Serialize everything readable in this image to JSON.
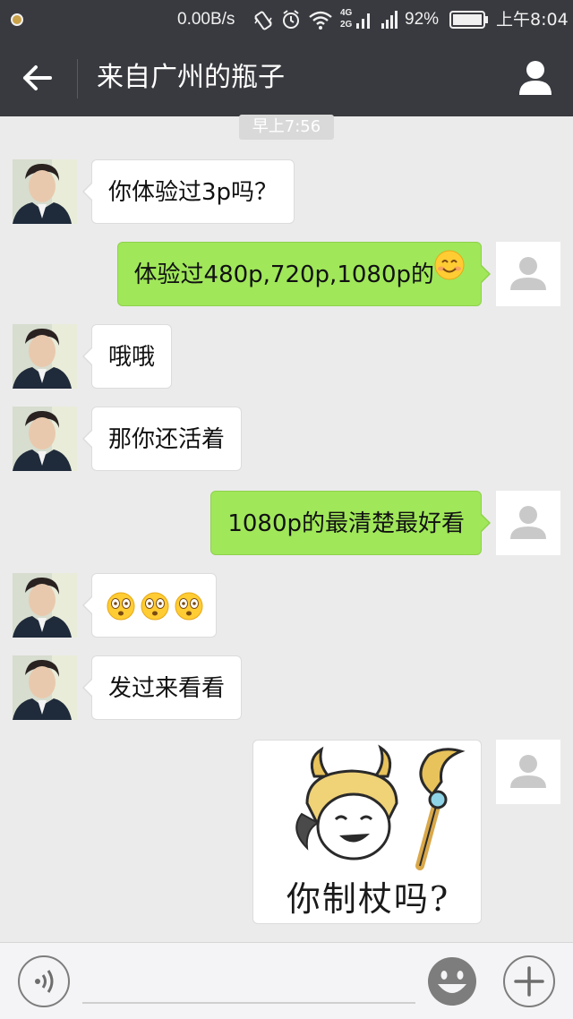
{
  "status_bar": {
    "network_speed": "0.00B/s",
    "network_labels": [
      "4G",
      "2G"
    ],
    "battery": "92%",
    "time": "上午8:04",
    "icons": [
      "wechat-notification-icon",
      "vibrate-icon",
      "alarm-icon",
      "wifi-icon",
      "signal-icon",
      "battery-icon"
    ]
  },
  "header": {
    "title": "来自广州的瓶子",
    "back_icon": "arrow-left-icon",
    "contact_icon": "person-icon",
    "background": "#393a3f"
  },
  "chat": {
    "timestamp": "早上7:56",
    "messages": [
      {
        "side": "left",
        "text": "你体验过3p吗？"
      },
      {
        "side": "right",
        "text": "体验过480p,720p,1080p的",
        "emoji": "smile-emoji"
      },
      {
        "side": "left",
        "text": "哦哦"
      },
      {
        "side": "left",
        "text": "那你还活着"
      },
      {
        "side": "right",
        "text": "1080p的最清楚最好看"
      },
      {
        "side": "left",
        "text": "",
        "emoji": "shocked-emoji x3"
      },
      {
        "side": "left",
        "text": "发过来看看"
      },
      {
        "side": "right",
        "type": "sticker",
        "caption": "你制杖吗?"
      }
    ],
    "colors": {
      "sent_bubble": "#a0e75a",
      "received_bubble": "#ffffff",
      "background": "#ebebeb"
    }
  },
  "input_bar": {
    "voice_icon": "voice-icon",
    "emoji_icon": "emoji-face-icon",
    "plus_icon": "plus-icon",
    "text_value": ""
  }
}
